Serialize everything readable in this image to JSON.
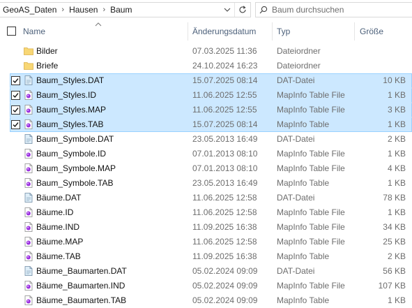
{
  "address": {
    "breadcrumbs": [
      "GeoAS_Daten",
      "Hausen",
      "Baum"
    ],
    "separator": "›"
  },
  "search": {
    "placeholder": "Baum durchsuchen"
  },
  "columns": {
    "name": "Name",
    "date": "Änderungsdatum",
    "type": "Typ",
    "size": "Größe"
  },
  "files": [
    {
      "name": "Bilder",
      "date": "07.03.2025 11:36",
      "type": "Dateiordner",
      "size": "",
      "icon": "folder-icon",
      "selected": false
    },
    {
      "name": "Briefe",
      "date": "24.10.2024 16:23",
      "type": "Dateiordner",
      "size": "",
      "icon": "folder-icon",
      "selected": false
    },
    {
      "name": "Baum_Styles.DAT",
      "date": "15.07.2025 08:14",
      "type": "DAT-Datei",
      "size": "10 KB",
      "icon": "dat-file-icon",
      "selected": true
    },
    {
      "name": "Baum_Styles.ID",
      "date": "11.06.2025 12:55",
      "type": "MapInfo Table File",
      "size": "1 KB",
      "icon": "mapinfo-icon",
      "selected": true
    },
    {
      "name": "Baum_Styles.MAP",
      "date": "11.06.2025 12:55",
      "type": "MapInfo Table File",
      "size": "3 KB",
      "icon": "mapinfo-icon",
      "selected": true
    },
    {
      "name": "Baum_Styles.TAB",
      "date": "15.07.2025 08:14",
      "type": "MapInfo Table",
      "size": "1 KB",
      "icon": "mapinfo-icon",
      "selected": true
    },
    {
      "name": "Baum_Symbole.DAT",
      "date": "23.05.2013 16:49",
      "type": "DAT-Datei",
      "size": "2 KB",
      "icon": "dat-file-icon",
      "selected": false
    },
    {
      "name": "Baum_Symbole.ID",
      "date": "07.01.2013 08:10",
      "type": "MapInfo Table File",
      "size": "1 KB",
      "icon": "mapinfo-icon",
      "selected": false
    },
    {
      "name": "Baum_Symbole.MAP",
      "date": "07.01.2013 08:10",
      "type": "MapInfo Table File",
      "size": "4 KB",
      "icon": "mapinfo-icon",
      "selected": false
    },
    {
      "name": "Baum_Symbole.TAB",
      "date": "23.05.2013 16:49",
      "type": "MapInfo Table",
      "size": "1 KB",
      "icon": "mapinfo-icon",
      "selected": false
    },
    {
      "name": "Bäume.DAT",
      "date": "11.06.2025 12:58",
      "type": "DAT-Datei",
      "size": "78 KB",
      "icon": "dat-file-icon",
      "selected": false
    },
    {
      "name": "Bäume.ID",
      "date": "11.06.2025 12:58",
      "type": "MapInfo Table File",
      "size": "1 KB",
      "icon": "mapinfo-icon",
      "selected": false
    },
    {
      "name": "Bäume.IND",
      "date": "11.09.2025 16:38",
      "type": "MapInfo Table File",
      "size": "34 KB",
      "icon": "mapinfo-icon",
      "selected": false
    },
    {
      "name": "Bäume.MAP",
      "date": "11.06.2025 12:58",
      "type": "MapInfo Table File",
      "size": "25 KB",
      "icon": "mapinfo-icon",
      "selected": false
    },
    {
      "name": "Bäume.TAB",
      "date": "11.09.2025 16:38",
      "type": "MapInfo Table",
      "size": "2 KB",
      "icon": "mapinfo-icon",
      "selected": false
    },
    {
      "name": "Bäume_Baumarten.DAT",
      "date": "05.02.2024 09:09",
      "type": "DAT-Datei",
      "size": "56 KB",
      "icon": "dat-file-icon",
      "selected": false
    },
    {
      "name": "Bäume_Baumarten.IND",
      "date": "05.02.2024 09:09",
      "type": "MapInfo Table File",
      "size": "107 KB",
      "icon": "mapinfo-icon",
      "selected": false
    },
    {
      "name": "Bäume_Baumarten.TAB",
      "date": "05.02.2024 09:09",
      "type": "MapInfo Table",
      "size": "1 KB",
      "icon": "mapinfo-icon",
      "selected": false
    }
  ],
  "colors": {
    "selection_fill": "#cce8ff",
    "selection_border": "#99d1ff",
    "header_text": "#4c607a",
    "folder": "#f8d775",
    "mapinfo_accent": "#9b2fe0"
  }
}
